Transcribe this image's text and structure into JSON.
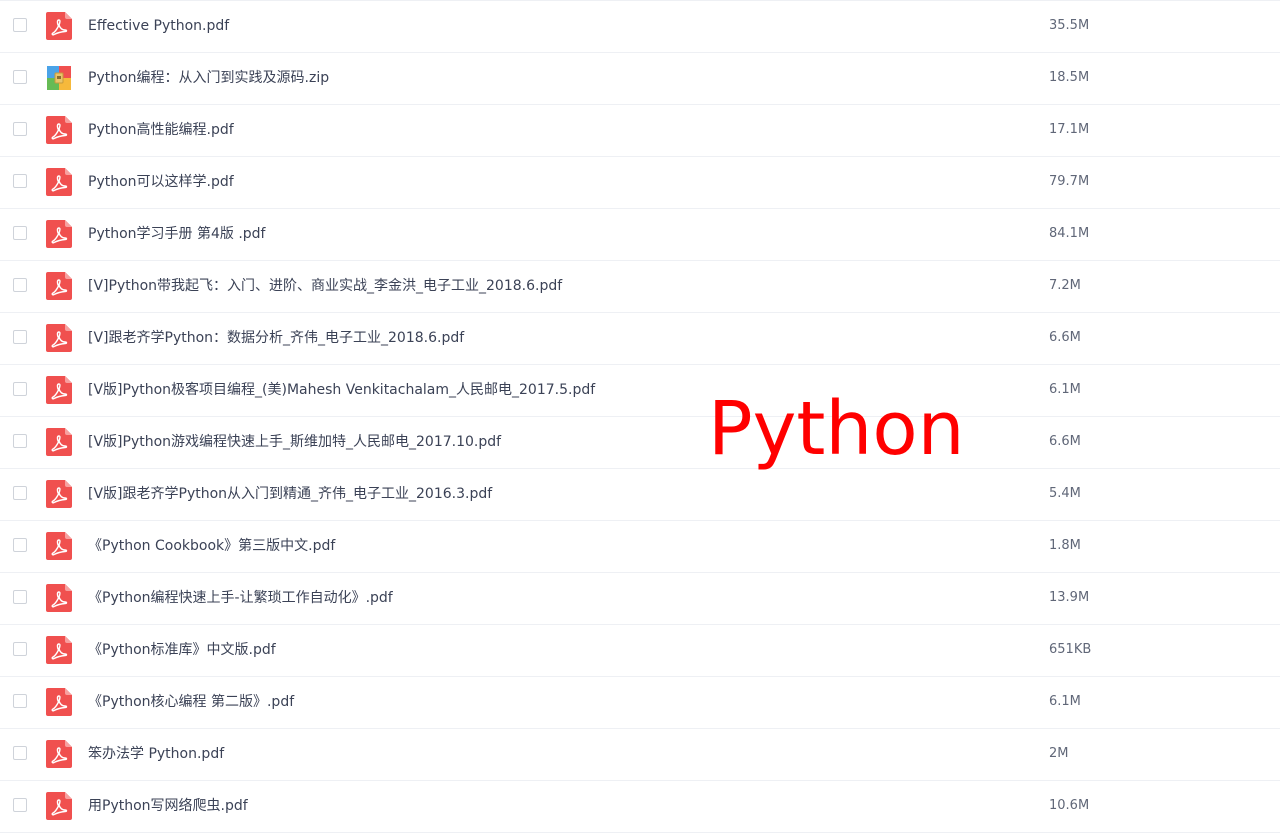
{
  "files": [
    {
      "name": "Effective Python.pdf",
      "size": "35.5M",
      "icon": "pdf-icon"
    },
    {
      "name": "Python编程：从入门到实践及源码.zip",
      "size": "18.5M",
      "icon": "zip-archive-icon"
    },
    {
      "name": "Python高性能编程.pdf",
      "size": "17.1M",
      "icon": "pdf-icon"
    },
    {
      "name": "Python可以这样学.pdf",
      "size": "79.7M",
      "icon": "pdf-icon"
    },
    {
      "name": "Python学习手册 第4版 .pdf",
      "size": "84.1M",
      "icon": "pdf-icon"
    },
    {
      "name": "[V]Python带我起飞：入门、进阶、商业实战_李金洪_电子工业_2018.6.pdf",
      "size": "7.2M",
      "icon": "pdf-icon"
    },
    {
      "name": "[V]跟老齐学Python：数据分析_齐伟_电子工业_2018.6.pdf",
      "size": "6.6M",
      "icon": "pdf-icon"
    },
    {
      "name": "[V版]Python极客项目编程_(美)Mahesh Venkitachalam_人民邮电_2017.5.pdf",
      "size": "6.1M",
      "icon": "pdf-icon"
    },
    {
      "name": "[V版]Python游戏编程快速上手_斯维加特_人民邮电_2017.10.pdf",
      "size": "6.6M",
      "icon": "pdf-icon"
    },
    {
      "name": "[V版]跟老齐学Python从入门到精通_齐伟_电子工业_2016.3.pdf",
      "size": "5.4M",
      "icon": "pdf-icon"
    },
    {
      "name": "《Python Cookbook》第三版中文.pdf",
      "size": "1.8M",
      "icon": "pdf-icon"
    },
    {
      "name": "《Python编程快速上手-让繁琐工作自动化》.pdf",
      "size": "13.9M",
      "icon": "pdf-icon"
    },
    {
      "name": "《Python标准库》中文版.pdf",
      "size": "651KB",
      "icon": "pdf-icon"
    },
    {
      "name": "《Python核心编程 第二版》.pdf",
      "size": "6.1M",
      "icon": "pdf-icon"
    },
    {
      "name": "笨办法学 Python.pdf",
      "size": "2M",
      "icon": "pdf-icon"
    },
    {
      "name": "用Python写网络爬虫.pdf",
      "size": "10.6M",
      "icon": "pdf-icon"
    }
  ],
  "watermark": "Python",
  "colors": {
    "pdf_icon": "#f0504f",
    "watermark": "#ff0000"
  }
}
